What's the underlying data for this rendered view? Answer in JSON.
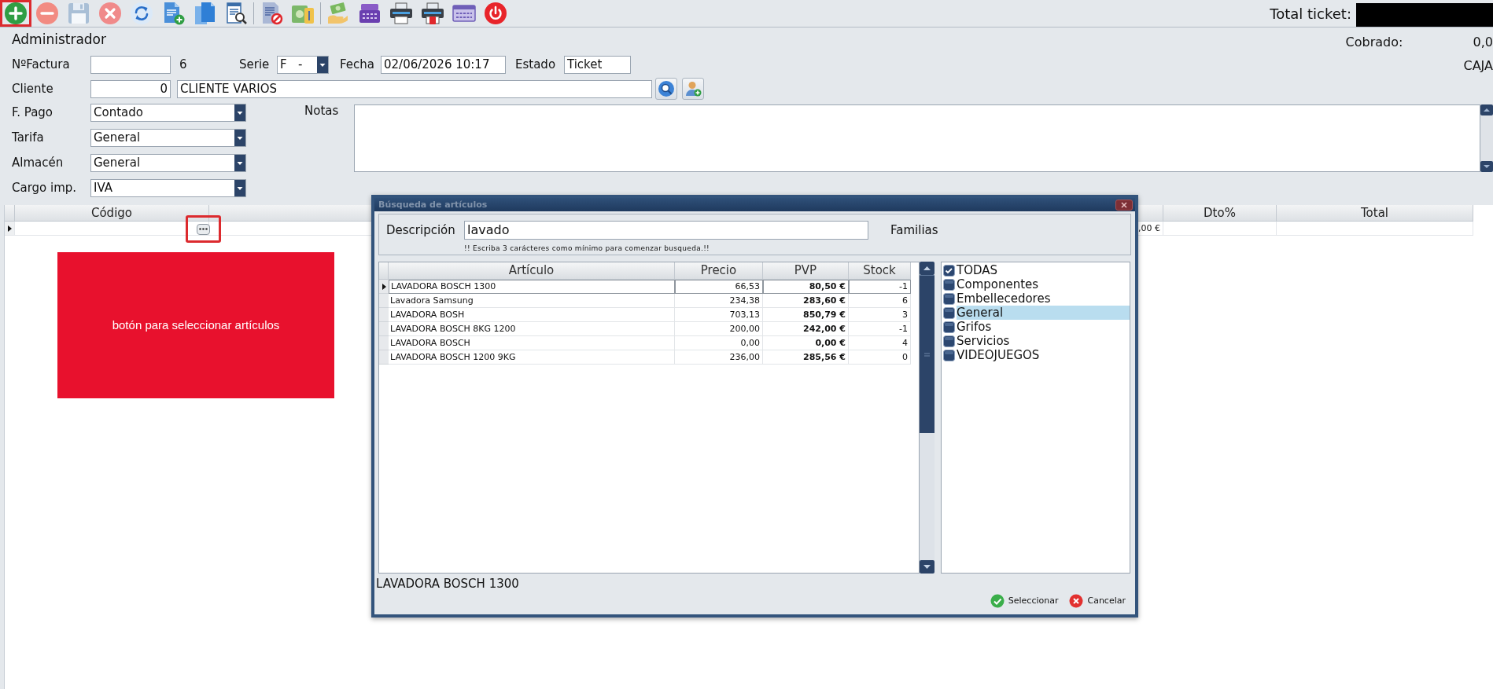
{
  "toolbar": {
    "buttons": [
      {
        "kind": "add",
        "highlighted": true
      },
      {
        "kind": "remove",
        "highlighted": false
      },
      {
        "kind": "save",
        "highlighted": false
      },
      {
        "kind": "cancel",
        "highlighted": false
      },
      {
        "kind": "refresh",
        "highlighted": false
      },
      {
        "kind": "new",
        "highlighted": false
      },
      {
        "kind": "duplicate",
        "highlighted": false
      },
      {
        "kind": "browse",
        "highlighted": false
      },
      {
        "kind": "separator"
      },
      {
        "kind": "void",
        "highlighted": false
      },
      {
        "kind": "payment",
        "highlighted": false
      },
      {
        "kind": "separator"
      },
      {
        "kind": "collect",
        "highlighted": false
      },
      {
        "kind": "register",
        "highlighted": false
      },
      {
        "kind": "print",
        "highlighted": false
      },
      {
        "kind": "reprint",
        "highlighted": false
      },
      {
        "kind": "form",
        "highlighted": false
      },
      {
        "kind": "power",
        "highlighted": false
      }
    ]
  },
  "total_ticket": {
    "label": "Total ticket:"
  },
  "user": "Administrador",
  "cobrado": {
    "label": "Cobrado:",
    "value": "0,0"
  },
  "caja": "CAJA",
  "factura": {
    "label": "NºFactura",
    "number": "6"
  },
  "serie": {
    "label": "Serie",
    "value": "F   -"
  },
  "fecha": {
    "label": "Fecha",
    "value": "02/06/2026 10:17"
  },
  "estado": {
    "label": "Estado",
    "value": "Ticket"
  },
  "cliente": {
    "label": "Cliente",
    "code": "0",
    "name": "CLIENTE VARIOS"
  },
  "selects": [
    {
      "label": "F. Pago",
      "value": "Contado"
    },
    {
      "label": "Tarifa",
      "value": "General"
    },
    {
      "label": "Almacén",
      "value": "General"
    },
    {
      "label": "Cargo imp.",
      "value": "IVA"
    }
  ],
  "notas": {
    "label": "Notas"
  },
  "lines_grid": {
    "columns": [
      "Código",
      "Dto%",
      "Total"
    ],
    "rows": [
      {
        "selected": true,
        "lookup_highlighted": true,
        "column_2": ",00 €"
      }
    ]
  },
  "annotation": {
    "text": "botón para seleccionar artículos"
  },
  "dialog": {
    "title": "Búsqueda de artículos",
    "search": {
      "label": "Descripción",
      "value": "lavado",
      "hint": "!! Escriba 3 carácteres como mínimo para comenzar busqueda.!!"
    },
    "families_label": "Familias",
    "table": {
      "columns": [
        "Artículo",
        "Precio",
        "PVP",
        "Stock"
      ],
      "rows": [
        {
          "selected": true,
          "cells": [
            "LAVADORA BOSCH 1300",
            "66,53",
            "80,50 €",
            "-1"
          ]
        },
        {
          "selected": false,
          "cells": [
            "Lavadora Samsung",
            "234,38",
            "283,60 €",
            "6"
          ]
        },
        {
          "selected": false,
          "cells": [
            "LAVADORA BOSH",
            "703,13",
            "850,79 €",
            "3"
          ]
        },
        {
          "selected": false,
          "cells": [
            "LAVADORA BOSCH 8KG 1200",
            "200,00",
            "242,00 €",
            "-1"
          ]
        },
        {
          "selected": false,
          "cells": [
            "LAVADORA BOSCH",
            "0,00",
            "0,00 €",
            "4"
          ]
        },
        {
          "selected": false,
          "cells": [
            "LAVADORA BOSCH 1200 9KG",
            "236,00",
            "285,56 €",
            "0"
          ]
        }
      ]
    },
    "families": [
      {
        "label": "TODAS",
        "checked": true,
        "selected": false
      },
      {
        "label": "Componentes",
        "checked": false,
        "selected": false
      },
      {
        "label": "Embellecedores",
        "checked": false,
        "selected": false
      },
      {
        "label": "General",
        "checked": false,
        "selected": true
      },
      {
        "label": "Grifos",
        "checked": false,
        "selected": false
      },
      {
        "label": "Servicios",
        "checked": false,
        "selected": false
      },
      {
        "label": "VIDEOJUEGOS",
        "checked": false,
        "selected": false
      }
    ],
    "selected_article": "LAVADORA BOSCH 1300",
    "buttons": [
      {
        "kind": "accept",
        "label": "Seleccionar"
      },
      {
        "kind": "cancel",
        "label": "Cancelar"
      }
    ]
  }
}
